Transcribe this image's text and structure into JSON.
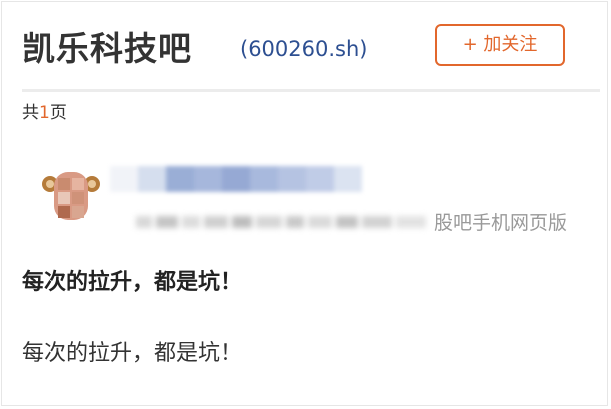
{
  "header": {
    "bar_name": "凯乐科技吧",
    "stock_code": "(600260.sh)",
    "follow_label": "+ 加关注"
  },
  "pagination": {
    "prefix": "共",
    "total_pages": "1",
    "suffix": "页"
  },
  "post": {
    "source_suffix": "股吧手机网页版",
    "title": "每次的拉升，都是坑！",
    "body": "每次的拉升，都是坑！"
  },
  "colors": {
    "accent": "#e2672c",
    "code_blue": "#2d4f91",
    "text": "#333333",
    "muted": "#999999"
  }
}
